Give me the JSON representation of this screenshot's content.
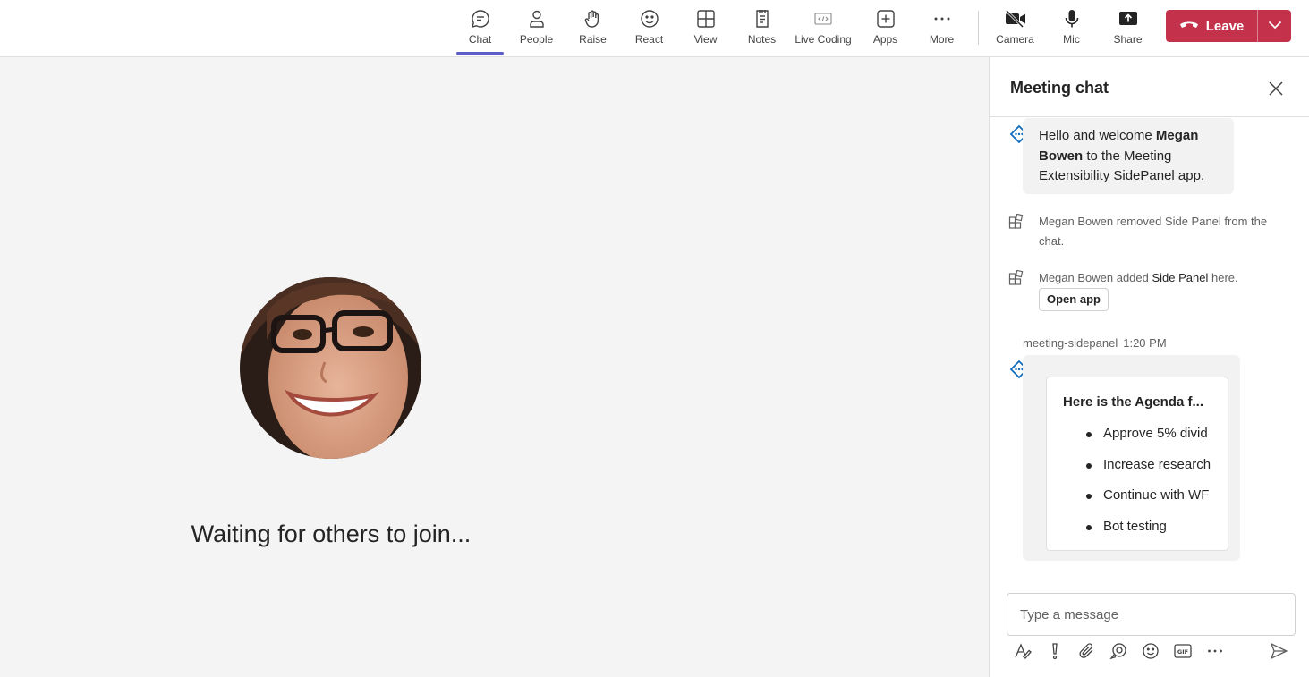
{
  "toolbar": {
    "chat": "Chat",
    "people": "People",
    "raise": "Raise",
    "react": "React",
    "view": "View",
    "notes": "Notes",
    "live_coding": "Live Coding",
    "apps": "Apps",
    "more": "More",
    "camera": "Camera",
    "mic": "Mic",
    "share": "Share",
    "leave": "Leave"
  },
  "stage": {
    "waiting_text": "Waiting for others to join..."
  },
  "chat": {
    "title": "Meeting chat",
    "welcome": {
      "prefix": "Hello and welcome ",
      "name": "Megan Bowen",
      "suffix": " to the Meeting Extensibility SidePanel app."
    },
    "sys_removed": "Megan Bowen removed Side Panel from the chat.",
    "sys_added": {
      "prefix": "Megan Bowen added ",
      "app": "Side Panel",
      "suffix": " here."
    },
    "open_app": "Open app",
    "sender": "meeting-sidepanel",
    "time": "1:20 PM",
    "card": {
      "title": "Here is the Agenda f...",
      "items": [
        "Approve 5% divid",
        "Increase research",
        "Continue with WF",
        "Bot testing"
      ]
    },
    "compose_placeholder": "Type a message"
  },
  "colors": {
    "accent": "#5b5fc7",
    "leave": "#c4314b",
    "stage_bg": "#f4f4f4",
    "status_green": "#13a10e",
    "bot_blue": "#0f6cbd"
  }
}
